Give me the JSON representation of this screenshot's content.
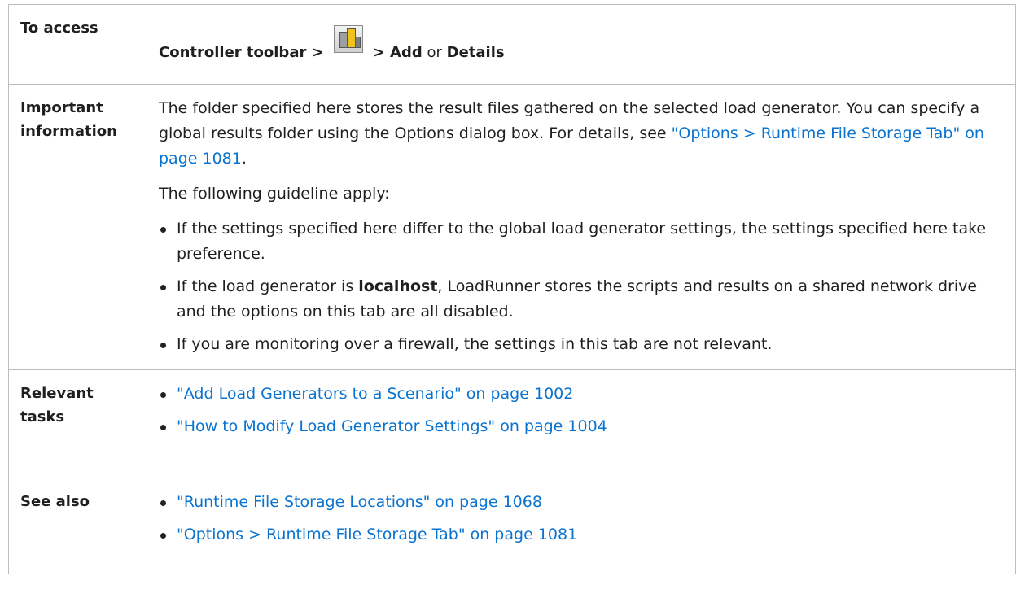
{
  "rows": {
    "access": {
      "label": "To access",
      "part1": "Controller toolbar >",
      "icon": "load-generators-icon",
      "part2": "> Add",
      "or": " or ",
      "part3": "Details"
    },
    "important": {
      "label": "Important information",
      "para1_text": "The folder specified here stores the result files gathered on the selected load generator. You can specify a global results folder using the Options dialog box. For details, see ",
      "para1_link": "\"Options > Runtime File Storage Tab\" on page 1081",
      "para1_end": ".",
      "para2": "The following guideline apply:",
      "bullet1": "If the settings specified here differ to the global load generator settings, the settings specified here take preference.",
      "bullet2_pre": "If the load generator is ",
      "bullet2_bold": "localhost",
      "bullet2_post": ", LoadRunner stores the scripts and results on a shared network drive and the options on this tab are all disabled.",
      "bullet3": "If you are monitoring over a firewall, the settings in this tab are not relevant."
    },
    "tasks": {
      "label": "Relevant tasks",
      "links": [
        "\"Add Load Generators to a Scenario\" on page 1002",
        "\"How to Modify Load Generator Settings\" on page 1004"
      ]
    },
    "see_also": {
      "label": "See also",
      "links": [
        "\"Runtime File Storage Locations\" on page 1068",
        "\"Options > Runtime File Storage Tab\" on page 1081"
      ]
    }
  },
  "colors": {
    "link": "#0a73d0",
    "border": "#bdbdbd",
    "text": "#1f1f1f"
  }
}
